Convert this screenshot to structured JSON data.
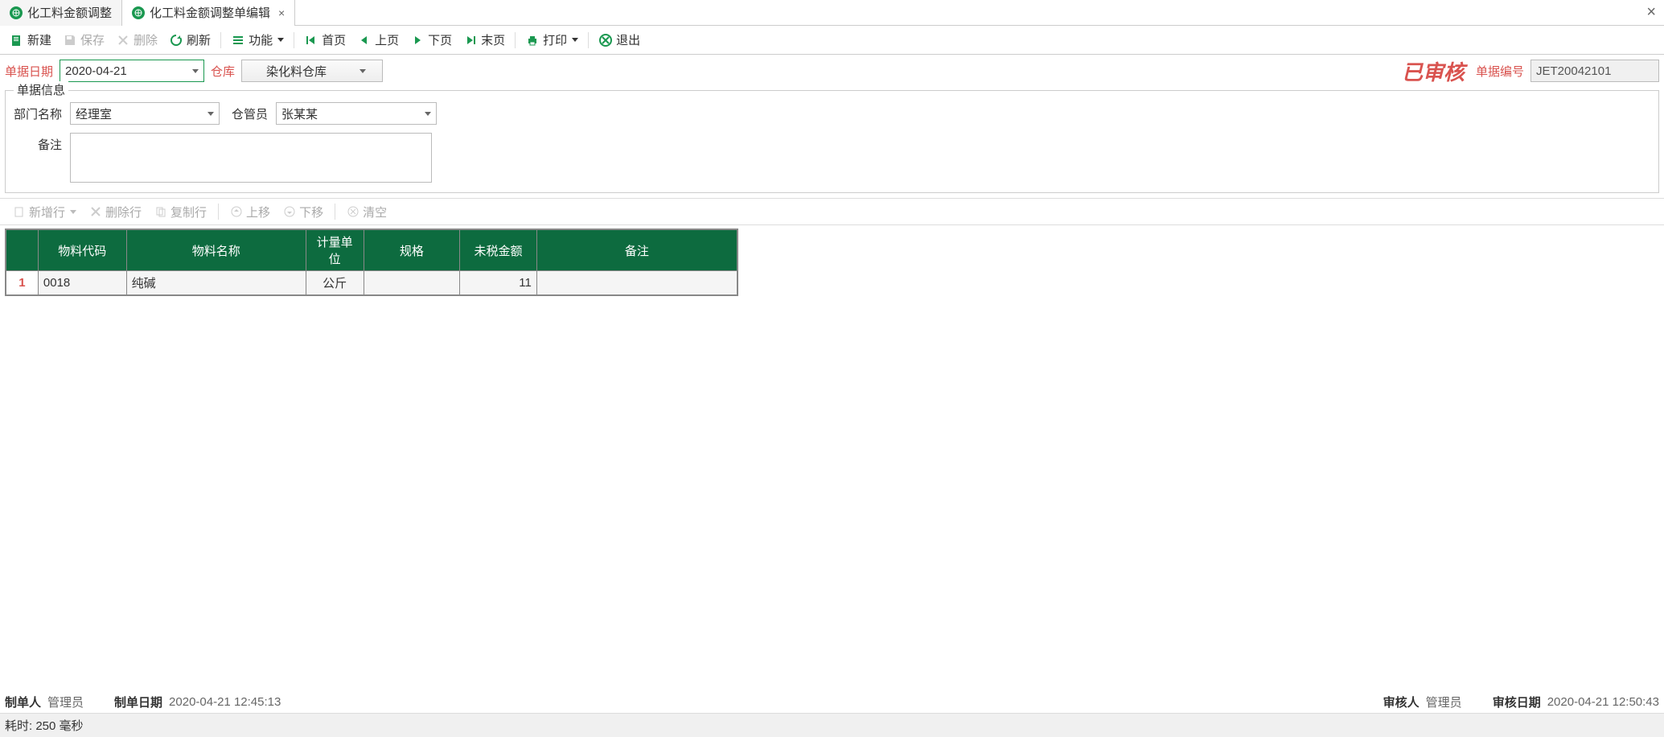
{
  "tabs": {
    "t0": "化工料金额调整",
    "t1": "化工料金额调整单编辑"
  },
  "toolbar": {
    "new": "新建",
    "save": "保存",
    "delete": "删除",
    "refresh": "刷新",
    "func": "功能",
    "first": "首页",
    "prev": "上页",
    "next": "下页",
    "last": "末页",
    "print": "打印",
    "exit": "退出"
  },
  "header": {
    "date_label": "单据日期",
    "date_value": "2020-04-21",
    "warehouse_label": "仓库",
    "warehouse_value": "染化料仓库",
    "stamp": "已审核",
    "doc_no_label": "单据编号",
    "doc_no_value": "JET20042101"
  },
  "fieldset": {
    "legend": "单据信息",
    "dept_label": "部门名称",
    "dept_value": "经理室",
    "keeper_label": "仓管员",
    "keeper_value": "张某某",
    "remark_label": "备注",
    "remark_value": ""
  },
  "subtoolbar": {
    "add": "新增行",
    "del": "删除行",
    "copy": "复制行",
    "up": "上移",
    "down": "下移",
    "clear": "清空"
  },
  "grid": {
    "cols": {
      "code": "物料代码",
      "name": "物料名称",
      "unit": "计量单位",
      "spec": "规格",
      "amount": "未税金额",
      "remark": "备注"
    },
    "rows": [
      {
        "idx": "1",
        "code": "0018",
        "name": "纯碱",
        "unit": "公斤",
        "spec": "",
        "amount": "11",
        "remark": ""
      }
    ]
  },
  "footer": {
    "creator_label": "制单人",
    "creator_value": "管理员",
    "create_date_label": "制单日期",
    "create_date_value": "2020-04-21 12:45:13",
    "auditor_label": "审核人",
    "auditor_value": "管理员",
    "audit_date_label": "审核日期",
    "audit_date_value": "2020-04-21 12:50:43",
    "elapsed": "耗时: 250 毫秒"
  }
}
